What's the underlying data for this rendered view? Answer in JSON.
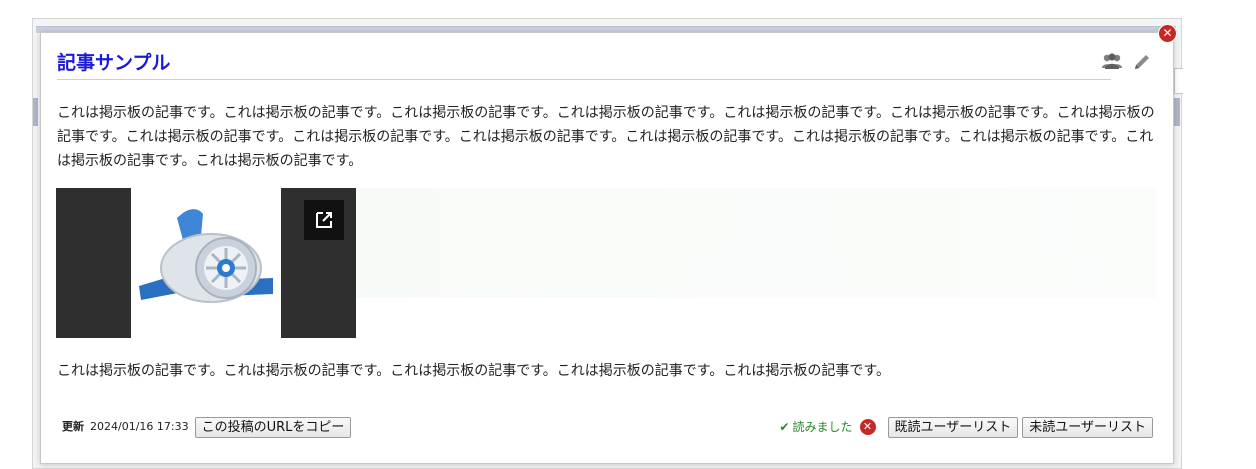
{
  "modal": {
    "title": "記事サンプル",
    "close_icon": "close-icon",
    "icons": [
      "users-icon",
      "pencil-icon"
    ],
    "body_paragraphs": [
      "これは掲示板の記事です。これは掲示板の記事です。これは掲示板の記事です。これは掲示板の記事です。これは掲示板の記事です。これは掲示板の記事です。これは掲示板の記事です。これは掲示板の記事です。これは掲示板の記事です。これは掲示板の記事です。これは掲示板の記事です。これは掲示板の記事です。これは掲示板の記事です。これは掲示板の記事です。これは掲示板の記事です。",
      "これは掲示板の記事です。これは掲示板の記事です。これは掲示板の記事です。これは掲示板の記事です。これは掲示板の記事です。"
    ],
    "media": {
      "image_icon": "app-engine-logo",
      "external_link_icon": "open-external-icon"
    }
  },
  "footer": {
    "updated_label": "更新",
    "updated_at": "2024/01/16 17:33",
    "copy_url_button": "この投稿のURLをコピー",
    "read_status": "読みました",
    "read_users_button": "既読ユーザーリスト",
    "unread_users_button": "未読ユーザーリスト"
  },
  "colors": {
    "title": "#1a1adb",
    "close": "#c62828",
    "read_status": "#2a8a2a"
  }
}
